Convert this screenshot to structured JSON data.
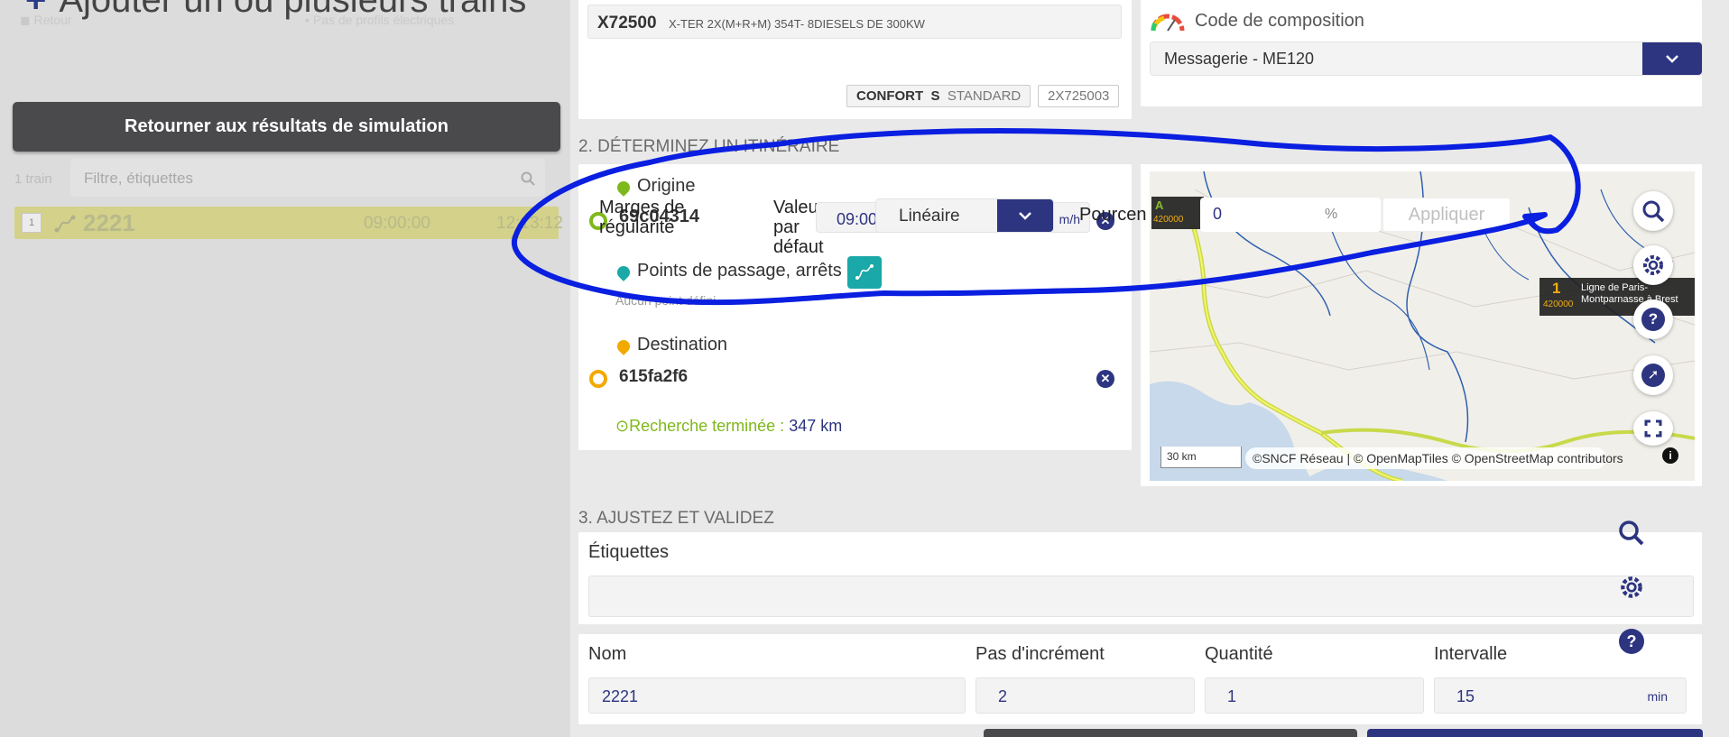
{
  "left": {
    "title": "Ajouter un ou plusieurs trains",
    "faded_left": "Retour",
    "faded_right": "Pas de profils électriques",
    "back_button": "Retourner aux résultats de simulation",
    "train_count": "1 train",
    "filter_placeholder": "Filtre, étiquettes",
    "trains": [
      {
        "index": "1",
        "name": "2221",
        "start": "09:00:00",
        "end": "12:13:12"
      }
    ]
  },
  "rolling_stock": {
    "code": "X72500",
    "description": "X-TER 2X(M+R+M) 354T- 8DIESELS DE 300KW",
    "comfort_label": "CONFORT",
    "comfort_short": "S",
    "comfort_value": "STANDARD",
    "variant": "2X725003"
  },
  "composition": {
    "label": "Code de composition",
    "value": "Messagerie - ME120"
  },
  "itinerary": {
    "section_title": "2. DÉTERMINEZ UN ITINÉRAIRE",
    "origin_label": "Origine",
    "origin_value": "69c04314",
    "margins_label": "Marges de régularité",
    "default_value_label": "Valeur par défaut",
    "time_value": "09:00",
    "speed_unit_partial": "m/h",
    "margin_type": "Linéaire",
    "percent_label": "Pourcentage",
    "percent_value": "0",
    "percent_unit": "%",
    "apply_button": "Appliquer",
    "vias_label": "Points de passage, arrêts",
    "vias_empty": "Aucun point défini",
    "destination_label": "Destination",
    "destination_value": "615fa2f6",
    "search_done_label": "Recherche terminée :",
    "distance": "347 km"
  },
  "map": {
    "scale": "30 km",
    "attribution": "©SNCF Réseau | © OpenMapTiles © OpenStreetMap contributors",
    "line_tooltip_number": "1",
    "line_tooltip_code": "420000",
    "line_tooltip_name": "Ligne de Paris-Montparnasse à Brest",
    "left_tooltip_code": "420000",
    "left_tooltip_letter": "A"
  },
  "validate": {
    "section_title": "3. AJUSTEZ ET VALIDEZ",
    "tags_label": "Étiquettes",
    "name_label": "Nom",
    "name_value": "2221",
    "increment_label": "Pas d'incrément",
    "increment_value": "2",
    "quantity_label": "Quantité",
    "quantity_value": "1",
    "interval_label": "Intervalle",
    "interval_value": "15",
    "interval_unit": "min"
  },
  "colors": {
    "primary": "#2d3480",
    "annotation": "#0a1fe0",
    "highlight": "#d3d18a",
    "green": "#7fb81a",
    "teal": "#1aa8a8",
    "orange": "#f2a900"
  }
}
